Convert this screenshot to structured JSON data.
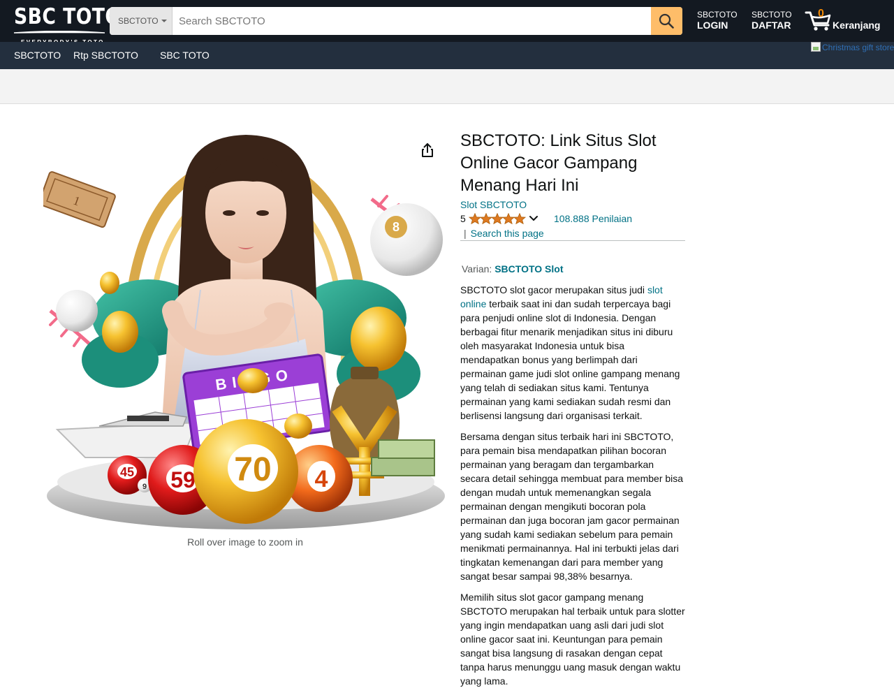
{
  "brand": {
    "logo_text": "SBC TOTO",
    "tagline": "EVERYBODY'S TOTO"
  },
  "search": {
    "category": "SBCTOTO",
    "placeholder": "Search SBCTOTO"
  },
  "account": {
    "login_small": "SBCTOTO",
    "login_big": "LOGIN",
    "daftar_small": "SBCTOTO",
    "daftar_big": "DAFTAR"
  },
  "cart": {
    "count": "0",
    "label": "Keranjang"
  },
  "subnav": {
    "links": [
      "SBCTOTO",
      "Rtp SBCTOTO",
      "SBC TOTO"
    ],
    "promo_alt": "Christmas gift store"
  },
  "product": {
    "zoom_hint": "Roll over image to zoom in",
    "title": "SBCTOTO: Link Situs Slot Online Gacor Gampang Menang Hari Ini",
    "byline": "Slot SBCTOTO",
    "rating": "5",
    "stars": 5,
    "reviews": "108.888 Penilaian",
    "search_pipe": "|",
    "search_page": "Search this page",
    "variant_label": "Varian:",
    "variant_value": "SBCTOTO Slot",
    "para1_a": "SBCTOTO slot gacor merupakan situs judi ",
    "para1_link": "slot online",
    "para1_b": " terbaik saat ini dan sudah terpercaya bagi para penjudi online slot di Indonesia. Dengan berbagai fitur menarik menjadikan situs ini diburu oleh masyarakat Indonesia untuk bisa mendapatkan bonus yang berlimpah dari permainan game judi slot online gampang menang yang telah di sediakan situs kami. Tentunya permainan yang kami sediakan sudah resmi dan berlisensi langsung dari organisasi terkait.",
    "para2": "Bersama dengan situs terbaik hari ini SBCTOTO, para pemain bisa mendapatkan pilihan bocoran permainan yang beragam dan tergambarkan secara detail sehingga membuat para member bisa dengan mudah untuk memenangkan segala permainan dengan mengikuti bocoran pola permainan dan juga bocoran jam gacor permainan yang sudah kami sediakan sebelum para pemain menikmati permainannya. Hal ini terbukti jelas dari tingkatan kemenangan dari para member yang sangat besar sampai 98,38% besarnya.",
    "para3": "Memilih situs slot gacor gampang menang SBCTOTO merupakan hal terbaik untuk para slotter yang ingin mendapatkan uang asli dari judi slot online gacor saat ini. Keuntungan para pemain sangat bisa langsung di rasakan dengan cepat tanpa harus menunggu uang masuk dengan waktu yang lama."
  },
  "image_labels": {
    "bingo": "BINGO",
    "balls": [
      "70",
      "59",
      "4",
      "45",
      "8",
      "9"
    ]
  },
  "colors": {
    "nav_top": "#131921",
    "nav_sub": "#232f3e",
    "search_button": "#febd69",
    "link": "#007185",
    "star": "#de7921",
    "cart_count": "#f08804"
  }
}
